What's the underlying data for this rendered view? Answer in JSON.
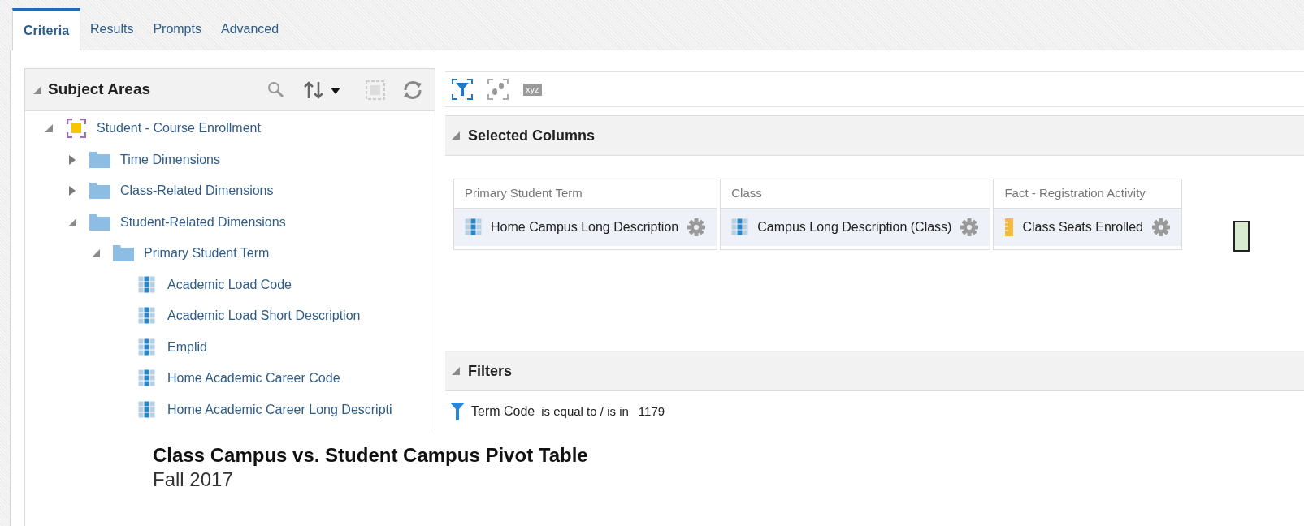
{
  "tabs": [
    {
      "label": "Criteria",
      "selected": true
    },
    {
      "label": "Results",
      "selected": false
    },
    {
      "label": "Prompts",
      "selected": false
    },
    {
      "label": "Advanced",
      "selected": false
    }
  ],
  "subject_areas": {
    "title": "Subject Areas",
    "expanded": true,
    "tree": [
      {
        "kind": "subject_area",
        "label": "Student - Course Enrollment",
        "expanded": true,
        "children": [
          {
            "kind": "folder",
            "label": "Time Dimensions",
            "expanded": false
          },
          {
            "kind": "folder",
            "label": "Class-Related Dimensions",
            "expanded": false
          },
          {
            "kind": "folder",
            "label": "Student-Related Dimensions",
            "expanded": true,
            "children": [
              {
                "kind": "folder",
                "label": "Primary Student Term",
                "expanded": true,
                "children": [
                  {
                    "kind": "column",
                    "label": "Academic Load Code"
                  },
                  {
                    "kind": "column",
                    "label": "Academic Load Short Description"
                  },
                  {
                    "kind": "column",
                    "label": "Emplid"
                  },
                  {
                    "kind": "column",
                    "label": "Home Academic Career Code"
                  },
                  {
                    "kind": "column",
                    "label": "Home Academic Career Long Descripti"
                  }
                ]
              }
            ]
          }
        ]
      }
    ]
  },
  "toolbar": {
    "xyz_label": "xyz"
  },
  "selected_columns": {
    "title": "Selected Columns",
    "expanded": true,
    "groups": [
      {
        "heading": "Primary Student Term",
        "column": {
          "kind": "attribute",
          "label": "Home Campus Long Description"
        }
      },
      {
        "heading": "Class",
        "column": {
          "kind": "attribute",
          "label": "Campus Long Description (Class)"
        }
      },
      {
        "heading": "Fact - Registration Activity",
        "column": {
          "kind": "measure",
          "label": "Class Seats Enrolled"
        }
      }
    ]
  },
  "filters": {
    "title": "Filters",
    "expanded": true,
    "items": [
      {
        "column": "Term Code",
        "operator": "is equal to / is in",
        "value": "1179"
      }
    ]
  },
  "overlay": {
    "title": "Class Campus vs. Student Campus Pivot Table",
    "subtitle": "Fall 2017"
  }
}
